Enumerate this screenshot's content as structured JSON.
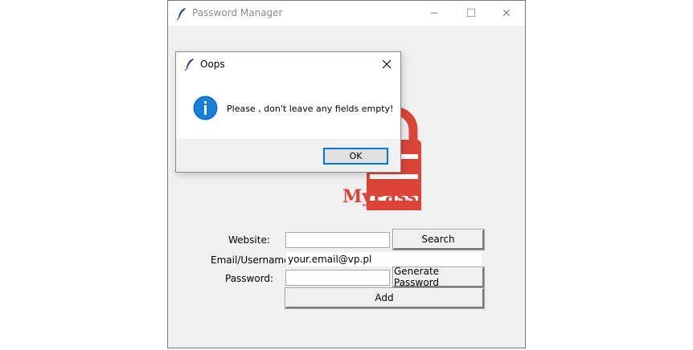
{
  "main_window": {
    "title": "Password Manager",
    "controls": {
      "minimize": "─",
      "maximize": "☐",
      "close": "✕"
    }
  },
  "logo": {
    "text": "MyPass",
    "color": "#db4437"
  },
  "form": {
    "website_label": "Website:",
    "website_value": "",
    "search_button": "Search",
    "email_label": "Email/Username:",
    "email_value": "your.email@vp.pl",
    "password_label": "Password:",
    "password_value": "",
    "generate_button": "Generate Password",
    "add_button": "Add"
  },
  "dialog": {
    "title": "Oops",
    "message": "Please , don't leave any fields empty!",
    "ok_button": "OK",
    "icon": "info-icon",
    "accent": "#0078d7"
  }
}
